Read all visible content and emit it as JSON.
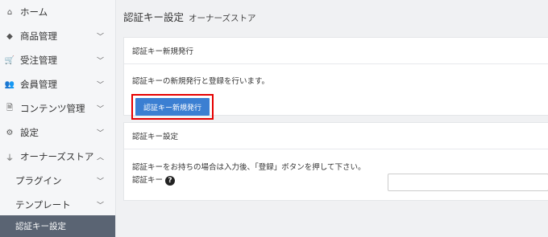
{
  "sidebar": {
    "items": [
      {
        "label": "ホーム",
        "icon": "home-icon",
        "glyph": "⌂",
        "chevron": ""
      },
      {
        "label": "商品管理",
        "icon": "cube-icon",
        "glyph": "◆",
        "chevron": "﹀"
      },
      {
        "label": "受注管理",
        "icon": "cart-icon",
        "glyph": "🛒",
        "chevron": "﹀"
      },
      {
        "label": "会員管理",
        "icon": "users-icon",
        "glyph": "👥",
        "chevron": "﹀"
      },
      {
        "label": "コンテンツ管理",
        "icon": "file-icon",
        "glyph": "🗎",
        "chevron": "﹀"
      },
      {
        "label": "設定",
        "icon": "gear-icon",
        "glyph": "⚙",
        "chevron": "﹀"
      },
      {
        "label": "オーナーズストア",
        "icon": "plug-icon",
        "glyph": "⏚",
        "chevron": "︿"
      }
    ],
    "sub_items": [
      {
        "label": "プラグイン",
        "chevron": "﹀"
      },
      {
        "label": "テンプレート",
        "chevron": "﹀"
      }
    ],
    "active_item": {
      "label": "認証キー設定"
    }
  },
  "header": {
    "title": "認証キー設定",
    "subtitle": "オーナーズストア"
  },
  "card1": {
    "title": "認証キー新規発行",
    "description": "認証キーの新規発行と登録を行います。",
    "button_label": "認証キー新規発行"
  },
  "card2": {
    "title": "認証キー設定",
    "description": "認証キーをお持ちの場合は入力後、「登録」ボタンを押して下さい。",
    "field_label": "認証キー",
    "field_value": ""
  },
  "colors": {
    "primary": "#3b7fd2",
    "highlight": "#e60000",
    "active_nav": "#5a6473"
  }
}
